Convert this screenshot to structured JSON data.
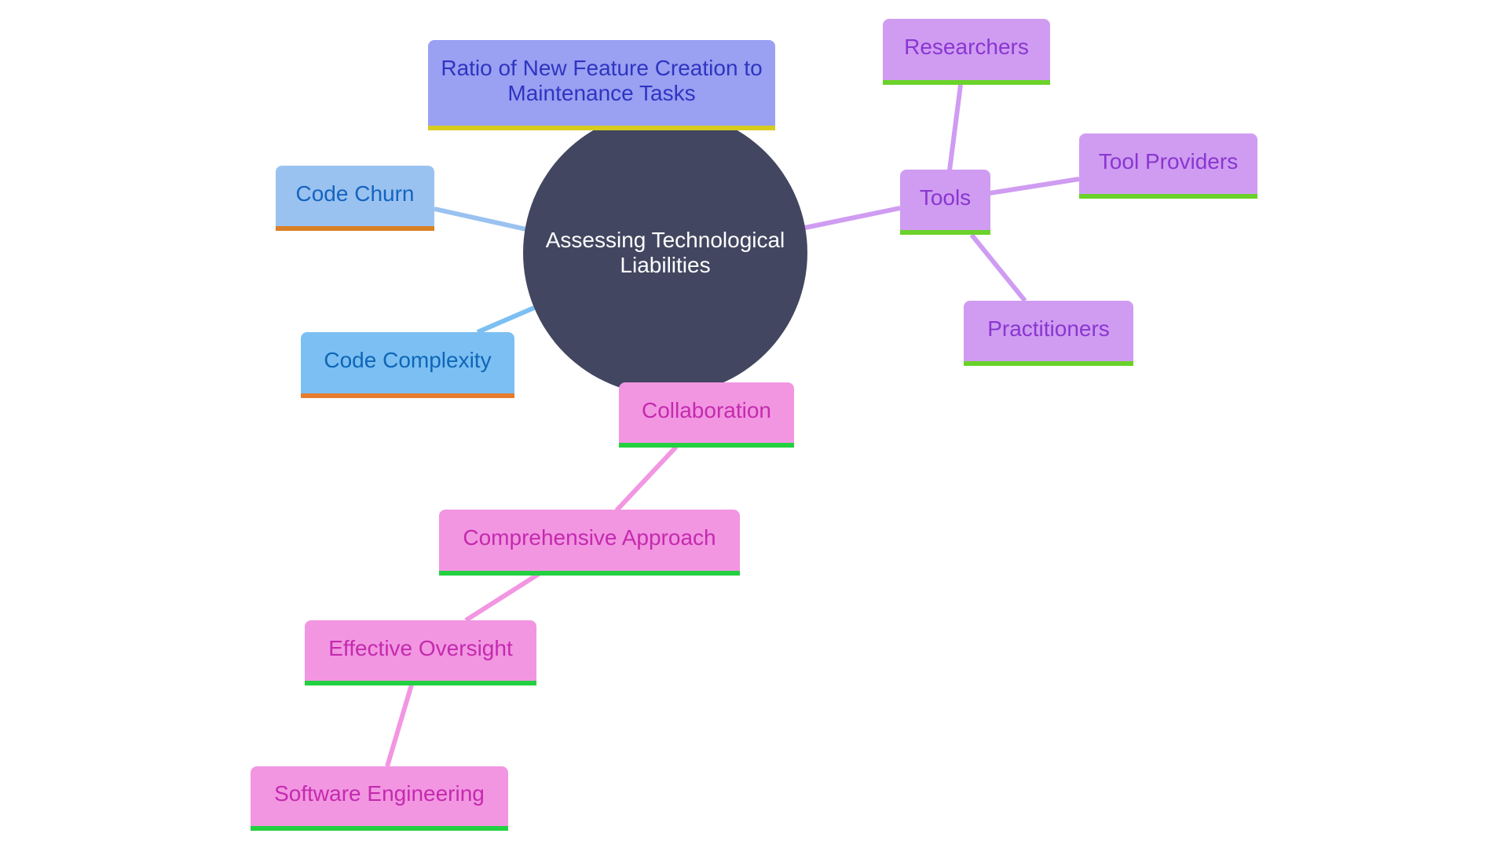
{
  "diagram": {
    "type": "mindmap",
    "root": {
      "label": "Assessing Technological Liabilities",
      "fill": "#424660",
      "text_color": "#ffffff"
    },
    "nodes": [
      {
        "id": "ratio",
        "label": "Ratio of New Feature Creation to Maintenance Tasks",
        "parent": "root",
        "fill": "#9aa0f2",
        "text_color": "#2e35c0",
        "bar_color": "#d6cc1e",
        "edge_color": "#9aa0f2"
      },
      {
        "id": "churn",
        "label": "Code Churn",
        "parent": "root",
        "fill": "#9ac2f0",
        "text_color": "#1464c0",
        "bar_color": "#d98026",
        "edge_color": "#9ac2f0"
      },
      {
        "id": "complexity",
        "label": "Code Complexity",
        "parent": "root",
        "fill": "#7cbff2",
        "text_color": "#0e66b8",
        "bar_color": "#e57c2e",
        "edge_color": "#7cbff2"
      },
      {
        "id": "tools",
        "label": "Tools",
        "parent": "root",
        "fill": "#cf9cf2",
        "text_color": "#8a36d0",
        "bar_color": "#6ad22a",
        "edge_color": "#cf9cf2"
      },
      {
        "id": "researchers",
        "label": "Researchers",
        "parent": "tools",
        "fill": "#cf9cf2",
        "text_color": "#8a36d0",
        "bar_color": "#6ad22a",
        "edge_color": "#cf9cf2"
      },
      {
        "id": "providers",
        "label": "Tool Providers",
        "parent": "tools",
        "fill": "#cf9cf2",
        "text_color": "#8a36d0",
        "bar_color": "#6ad22a",
        "edge_color": "#cf9cf2"
      },
      {
        "id": "practitioners",
        "label": "Practitioners",
        "parent": "tools",
        "fill": "#cf9cf2",
        "text_color": "#8a36d0",
        "bar_color": "#6ad22a",
        "edge_color": "#cf9cf2"
      },
      {
        "id": "collaboration",
        "label": "Collaboration",
        "parent": "root",
        "fill": "#f296e2",
        "text_color": "#c42aae",
        "bar_color": "#22d040",
        "edge_color": "#f296e2"
      },
      {
        "id": "comprehensive",
        "label": "Comprehensive Approach",
        "parent": "collaboration",
        "fill": "#f296e2",
        "text_color": "#c42aae",
        "bar_color": "#22d040",
        "edge_color": "#f296e2"
      },
      {
        "id": "oversight",
        "label": "Effective Oversight",
        "parent": "comprehensive",
        "fill": "#f296e2",
        "text_color": "#c42aae",
        "bar_color": "#22d040",
        "edge_color": "#f296e2"
      },
      {
        "id": "swe",
        "label": "Software Engineering",
        "parent": "oversight",
        "fill": "#f296e2",
        "text_color": "#c42aae",
        "bar_color": "#22d040",
        "edge_color": "#f296e2"
      }
    ]
  }
}
